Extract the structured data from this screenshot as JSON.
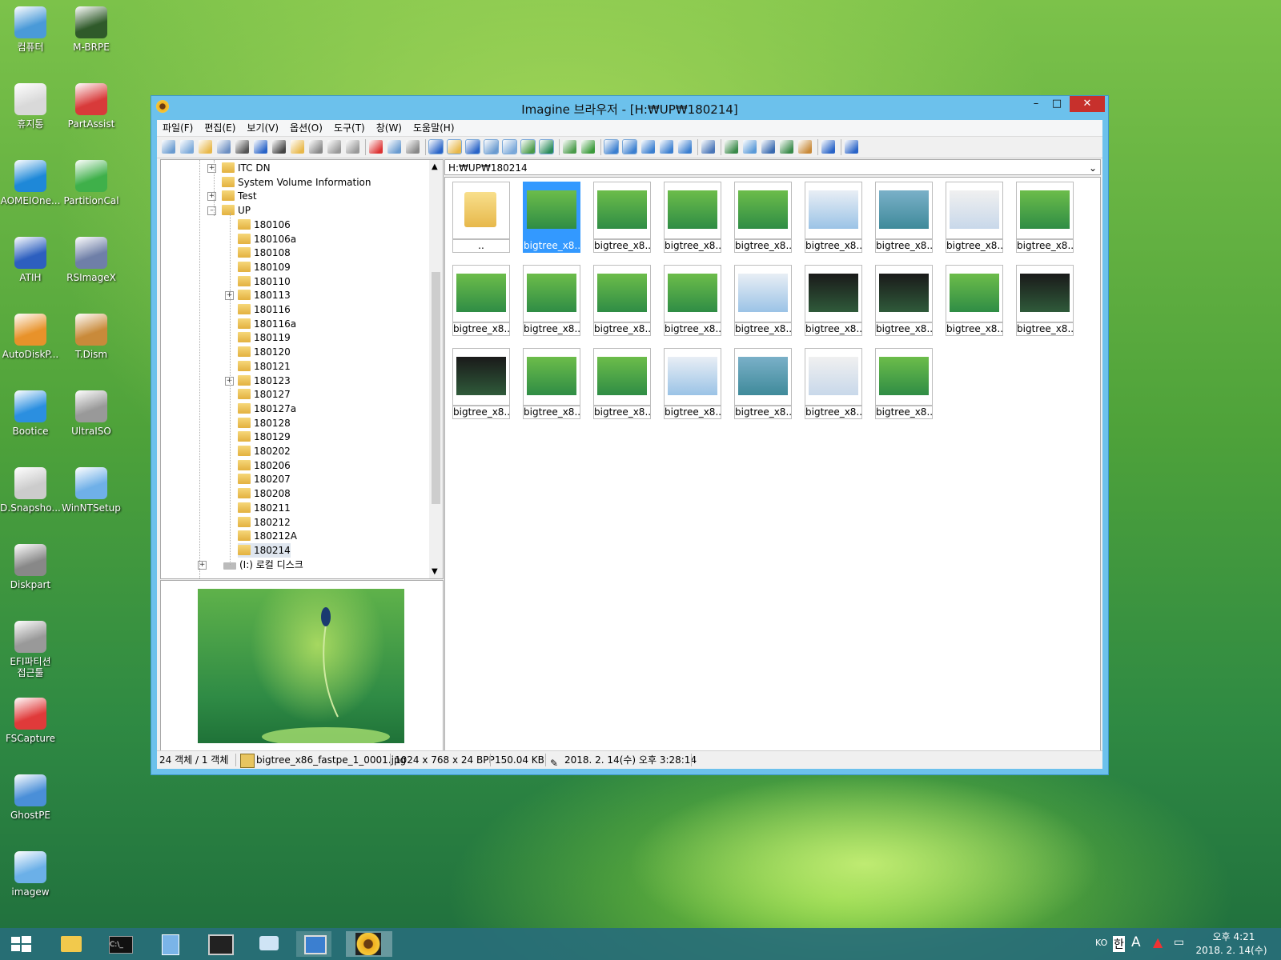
{
  "desktop_icons": [
    {
      "label": "컴퓨터",
      "icon": "computer-icon"
    },
    {
      "label": "M-BRPE",
      "icon": "drive-icon"
    },
    {
      "label": "휴지통",
      "icon": "recycle-bin-icon"
    },
    {
      "label": "PartAssist",
      "icon": "partassist-icon"
    },
    {
      "label": "AOMEIOne...",
      "icon": "aomei-icon"
    },
    {
      "label": "PartitionCal",
      "icon": "puzzle-icon"
    },
    {
      "label": "ATIH",
      "icon": "atih-icon"
    },
    {
      "label": "RSImageX",
      "icon": "rsimagex-icon"
    },
    {
      "label": "AutoDiskP...",
      "icon": "autodisk-icon"
    },
    {
      "label": "T.Dism",
      "icon": "tdism-icon"
    },
    {
      "label": "Bootice",
      "icon": "butterfly-icon"
    },
    {
      "label": "UltraISO",
      "icon": "disc-icon"
    },
    {
      "label": "D.Snapsho...",
      "icon": "drive-snapshot-icon"
    },
    {
      "label": "WinNTSetup",
      "icon": "winntsetup-icon"
    },
    {
      "label": "Diskpart",
      "icon": "diskpart-icon"
    },
    {
      "label": "EFI파티션\n접근툴",
      "icon": "tools-icon"
    },
    {
      "label": "FSCapture",
      "icon": "fscapture-icon"
    },
    {
      "label": "GhostPE",
      "icon": "ghost-icon"
    },
    {
      "label": "imagew",
      "icon": "imagew-icon"
    }
  ],
  "window": {
    "title": "Imagine 브라우저 - [H:₩UP₩180214]",
    "minimize": "–",
    "maximize": "□",
    "close": "✕"
  },
  "menu": [
    "파일(F)",
    "편집(E)",
    "보기(V)",
    "옵션(O)",
    "도구(T)",
    "창(W)",
    "도움말(H)"
  ],
  "tree": {
    "nodes": [
      {
        "label": "ITC DN",
        "expander": "+"
      },
      {
        "label": "System Volume Information",
        "expander": ""
      },
      {
        "label": "Test",
        "expander": "+"
      },
      {
        "label": "UP",
        "expander": "-"
      },
      {
        "label": "180106",
        "expander": ""
      },
      {
        "label": "180106a",
        "expander": ""
      },
      {
        "label": "180108",
        "expander": ""
      },
      {
        "label": "180109",
        "expander": ""
      },
      {
        "label": "180110",
        "expander": ""
      },
      {
        "label": "180113",
        "expander": "+"
      },
      {
        "label": "180116",
        "expander": ""
      },
      {
        "label": "180116a",
        "expander": ""
      },
      {
        "label": "180119",
        "expander": ""
      },
      {
        "label": "180120",
        "expander": ""
      },
      {
        "label": "180121",
        "expander": ""
      },
      {
        "label": "180123",
        "expander": "+"
      },
      {
        "label": "180127",
        "expander": ""
      },
      {
        "label": "180127a",
        "expander": ""
      },
      {
        "label": "180128",
        "expander": ""
      },
      {
        "label": "180129",
        "expander": ""
      },
      {
        "label": "180202",
        "expander": ""
      },
      {
        "label": "180206",
        "expander": ""
      },
      {
        "label": "180207",
        "expander": ""
      },
      {
        "label": "180208",
        "expander": ""
      },
      {
        "label": "180211",
        "expander": ""
      },
      {
        "label": "180212",
        "expander": ""
      },
      {
        "label": "180212A",
        "expander": ""
      },
      {
        "label": "180214",
        "expander": "",
        "selected": true
      },
      {
        "label": "(I:) 로컬 디스크",
        "expander": "+"
      }
    ]
  },
  "path": "H:₩UP₩180214",
  "thumbnails": [
    {
      "label": "..",
      "type": "folder"
    },
    {
      "label": "bigtree_x8...",
      "selected": true
    },
    {
      "label": "bigtree_x8..."
    },
    {
      "label": "bigtree_x8..."
    },
    {
      "label": "bigtree_x8..."
    },
    {
      "label": "bigtree_x8..."
    },
    {
      "label": "bigtree_x8..."
    },
    {
      "label": "bigtree_x8..."
    },
    {
      "label": "bigtree_x8..."
    },
    {
      "label": "bigtree_x8..."
    },
    {
      "label": "bigtree_x8..."
    },
    {
      "label": "bigtree_x8..."
    },
    {
      "label": "bigtree_x8..."
    },
    {
      "label": "bigtree_x8..."
    },
    {
      "label": "bigtree_x8..."
    },
    {
      "label": "bigtree_x8..."
    },
    {
      "label": "bigtree_x8..."
    },
    {
      "label": "bigtree_x8..."
    },
    {
      "label": "bigtree_x8..."
    },
    {
      "label": "bigtree_x8..."
    },
    {
      "label": "bigtree_x8..."
    },
    {
      "label": "bigtree_x8..."
    },
    {
      "label": "bigtree_x8..."
    },
    {
      "label": "bigtree_x8..."
    },
    {
      "label": "bigtree_x8..."
    }
  ],
  "status": {
    "count": "24 객체 / 1 객체",
    "filename": "bigtree_x86_fastpe_1_0001.jpg",
    "dimensions": "1024 x 768 x 24 BPP",
    "size": "150.04 KB",
    "date": "2018. 2. 14(수) 오후 3:28:14"
  },
  "taskbar": {
    "tray_lang": "KO",
    "tray_ime": "한",
    "tray_a": "A",
    "time": "오후 4:21",
    "date": "2018. 2. 14(수)"
  }
}
